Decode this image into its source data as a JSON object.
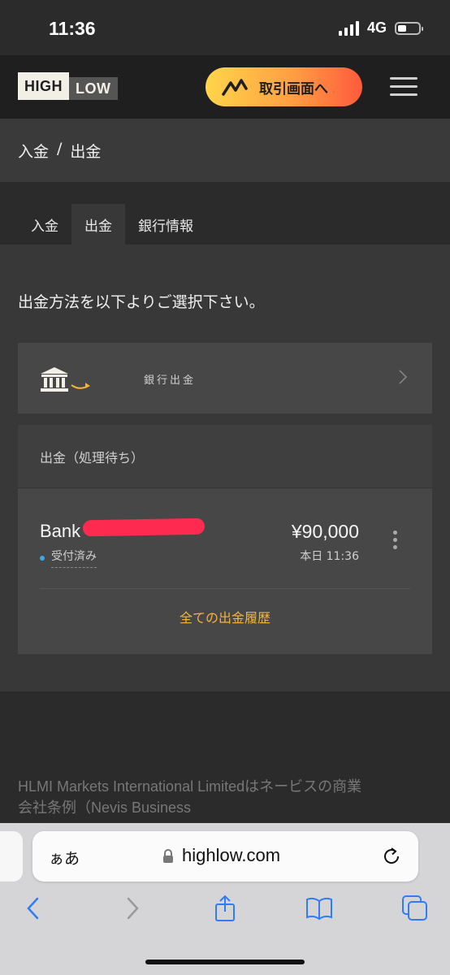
{
  "status_bar": {
    "time": "11:36",
    "network": "4G"
  },
  "header": {
    "logo_high": "HIGH",
    "logo_low": "LOW",
    "trade_button_label": "取引画面へ"
  },
  "breadcrumb": {
    "deposit": "入金",
    "separator": "/",
    "withdraw": "出金"
  },
  "tabs": [
    {
      "label": "入金"
    },
    {
      "label": "出金"
    },
    {
      "label": "銀行情報"
    }
  ],
  "instruction": "出金方法を以下よりご選択下さい。",
  "method": {
    "label": "銀行出金"
  },
  "pending": {
    "header": "出金（処理待ち）",
    "item": {
      "name": "Bank",
      "status": "受付済み",
      "amount": "¥90,000",
      "time": "本日 11:36"
    },
    "history_link": "全ての出金履歴"
  },
  "footer": {
    "text": "HLMI Markets International Limitedはネービスの商業会社条例（Nevis Business"
  },
  "browser": {
    "aa_label": "ぁあ",
    "url": "highlow.com"
  },
  "colors": {
    "accent_orange": "#f4b43c",
    "status_blue": "#3fa9e8",
    "redaction_red": "#ff2a4f"
  }
}
